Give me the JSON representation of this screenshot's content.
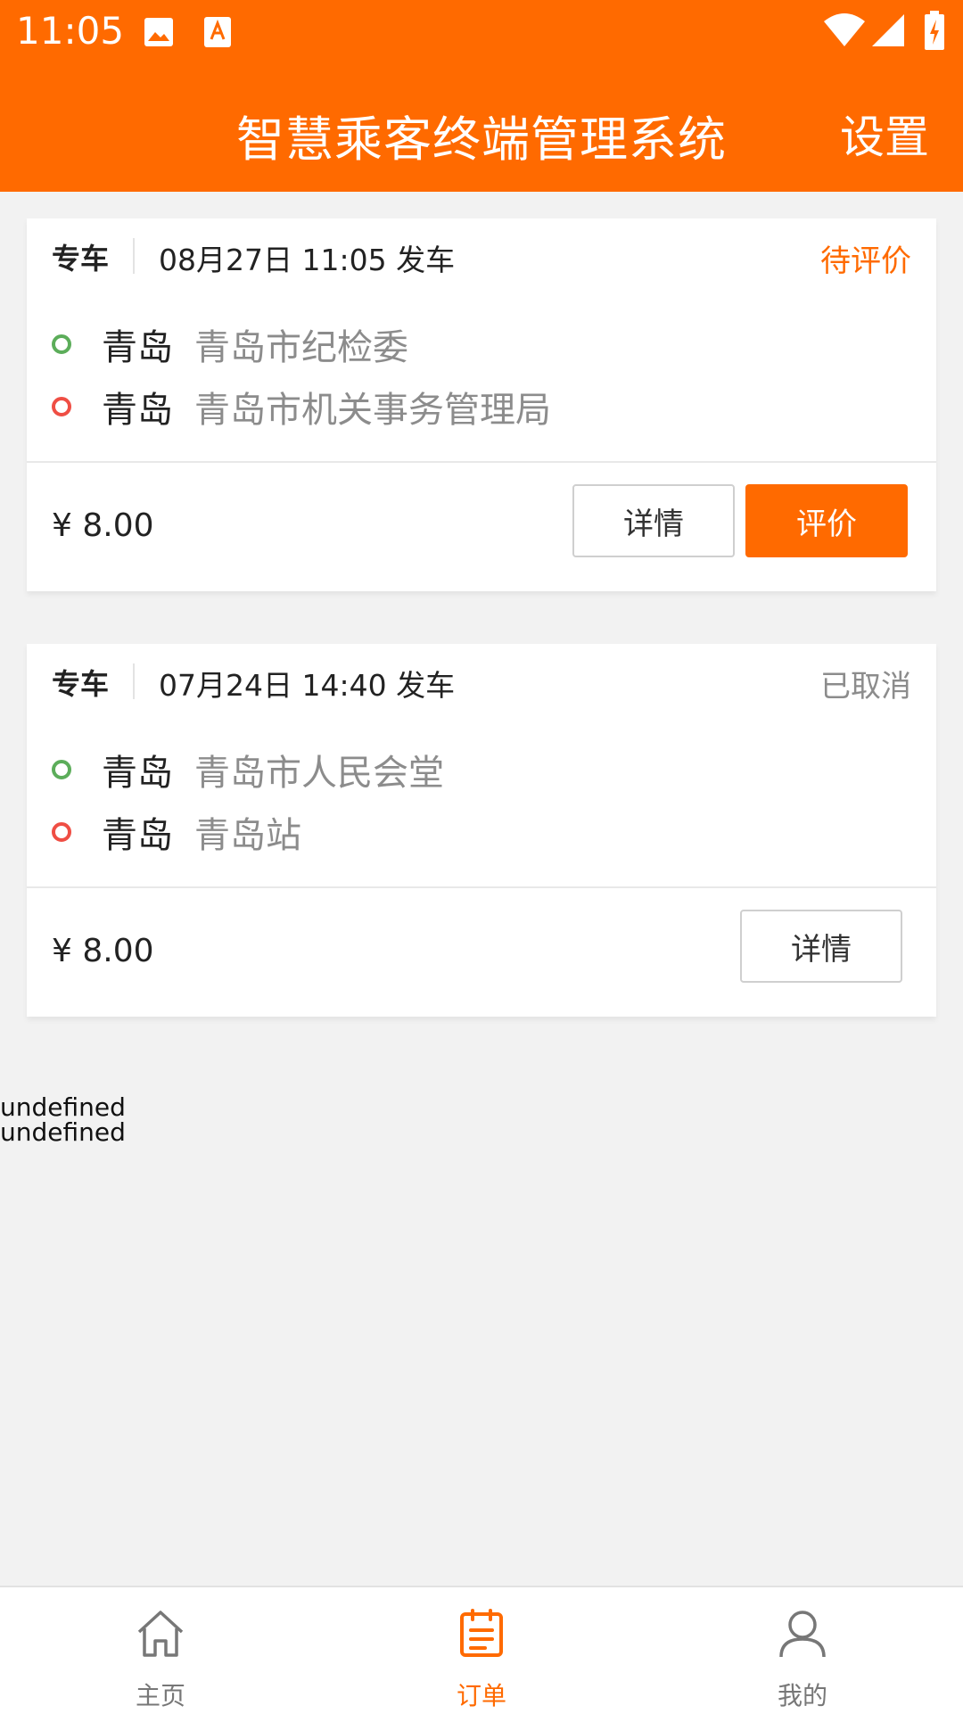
{
  "status_bar": {
    "time": "11:05",
    "icons": [
      "image-icon",
      "text-a-icon",
      "wifi-icon",
      "signal-icon",
      "battery-charging-icon"
    ]
  },
  "header": {
    "title": "智慧乘客终端管理系统",
    "settings_label": "设置"
  },
  "orders": [
    {
      "car_type": "专车",
      "depart_time": "08月27日 11:05 发车",
      "status": "待评价",
      "status_color": "#ff6a00",
      "from_city": "青岛",
      "from_place": "青岛市纪检委",
      "to_city": "青岛",
      "to_place": "青岛市机关事务管理局",
      "price": "¥ 8.00",
      "detail_label": "详情",
      "review_label": "评价"
    },
    {
      "car_type": "专车",
      "depart_time": "07月24日 14:40 发车",
      "status": "已取消",
      "status_color": "#8c8c8c",
      "from_city": "青岛",
      "from_place": "青岛市人民会堂",
      "to_city": "青岛",
      "to_place": "青岛站",
      "price": "¥ 8.00",
      "detail_label": "详情"
    }
  ],
  "debug_text": [
    "undefined",
    "undefined"
  ],
  "tabs": [
    {
      "label": "主页",
      "icon": "home-icon",
      "active": false
    },
    {
      "label": "订单",
      "icon": "clipboard-icon",
      "active": true
    },
    {
      "label": "我的",
      "icon": "user-icon",
      "active": false
    }
  ],
  "colors": {
    "accent": "#ff6a00",
    "start_dot": "#5cad5a",
    "end_dot": "#ef4e44",
    "background": "#f2f2f2"
  }
}
